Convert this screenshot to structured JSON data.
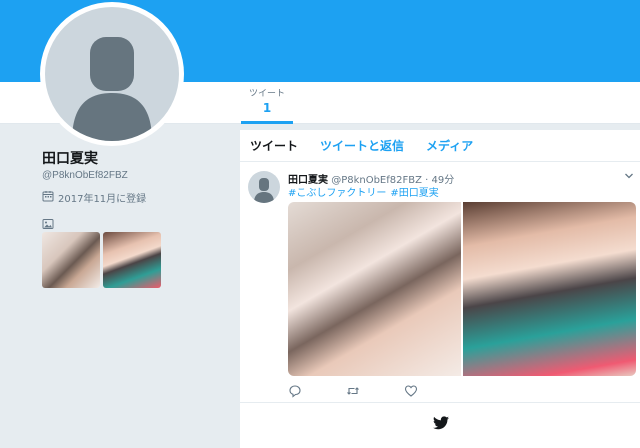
{
  "profile": {
    "name": "田口夏実",
    "handle": "@P8knObEf82FBZ",
    "joined": "2017年11月に登録"
  },
  "stats": {
    "tweets_label": "ツイート",
    "tweets_count": "1"
  },
  "timeline_tabs": [
    "ツイート",
    "ツイートと返信",
    "メディア"
  ],
  "tweet": {
    "name": "田口夏実",
    "handle": "@P8knObEf82FBZ",
    "separator": "·",
    "time": "49分",
    "hashtags": [
      "#こぶしファクトリー",
      "#田口夏実"
    ]
  },
  "colors": {
    "accent": "#1da1f2",
    "muted": "#657786",
    "background": "#e6ecf0"
  },
  "icons": {
    "joined": "calendar-icon",
    "photos": "image-icon",
    "reply": "reply-icon",
    "retweet": "retweet-icon",
    "like": "heart-icon",
    "footer": "twitter-bird-icon",
    "more": "chevron-down-icon"
  }
}
